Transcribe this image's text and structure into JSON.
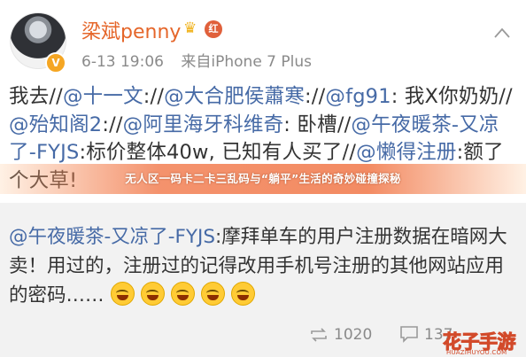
{
  "post": {
    "username": "梁斌penny",
    "level_badge": "红",
    "verified_badge": "V",
    "date": "6-13 19:06",
    "source": "来自iPhone 7 Plus",
    "segments": [
      {
        "text": "我去//",
        "mention": false
      },
      {
        "text": "@十一文",
        "mention": true
      },
      {
        "text": "://",
        "mention": false
      },
      {
        "text": "@大合肥侯蕭寒",
        "mention": true
      },
      {
        "text": "://",
        "mention": false
      },
      {
        "text": "@fg91",
        "mention": true
      },
      {
        "text": ": 我X你奶奶//",
        "mention": false
      },
      {
        "text": "@殆知阁2",
        "mention": true
      },
      {
        "text": "://",
        "mention": false
      },
      {
        "text": "@阿里海牙科维奇",
        "mention": true
      },
      {
        "text": ": 卧槽//",
        "mention": false
      },
      {
        "text": "@午夜暖茶-又凉了-FYJS",
        "mention": true
      },
      {
        "text": ":标价整体40w, 已知有人买了//",
        "mention": false
      },
      {
        "text": "@懒得注册",
        "mention": true
      },
      {
        "text": ":额了个大草!",
        "mention": false
      }
    ]
  },
  "banner": {
    "text": "无人区一码卡二卡三乱码与“躺平”生活的奇妙碰撞探秘"
  },
  "repost": {
    "author": "@午夜暖茶-又凉了-FYJS",
    "text": ":摩拜单车的用户注册数据在暗网大卖！用过的，注册过的记得改用手机号注册的其他网站应用的密码……",
    "emoji_count": 5
  },
  "footer": {
    "repost_count": "1020",
    "comment_count": "137"
  },
  "watermark": {
    "text": "花子手游",
    "subtext": "HUAZIHUYOU.COM"
  },
  "colors": {
    "username": "#e5662a",
    "mention": "#466aa6",
    "banner": "#f06e3c"
  }
}
